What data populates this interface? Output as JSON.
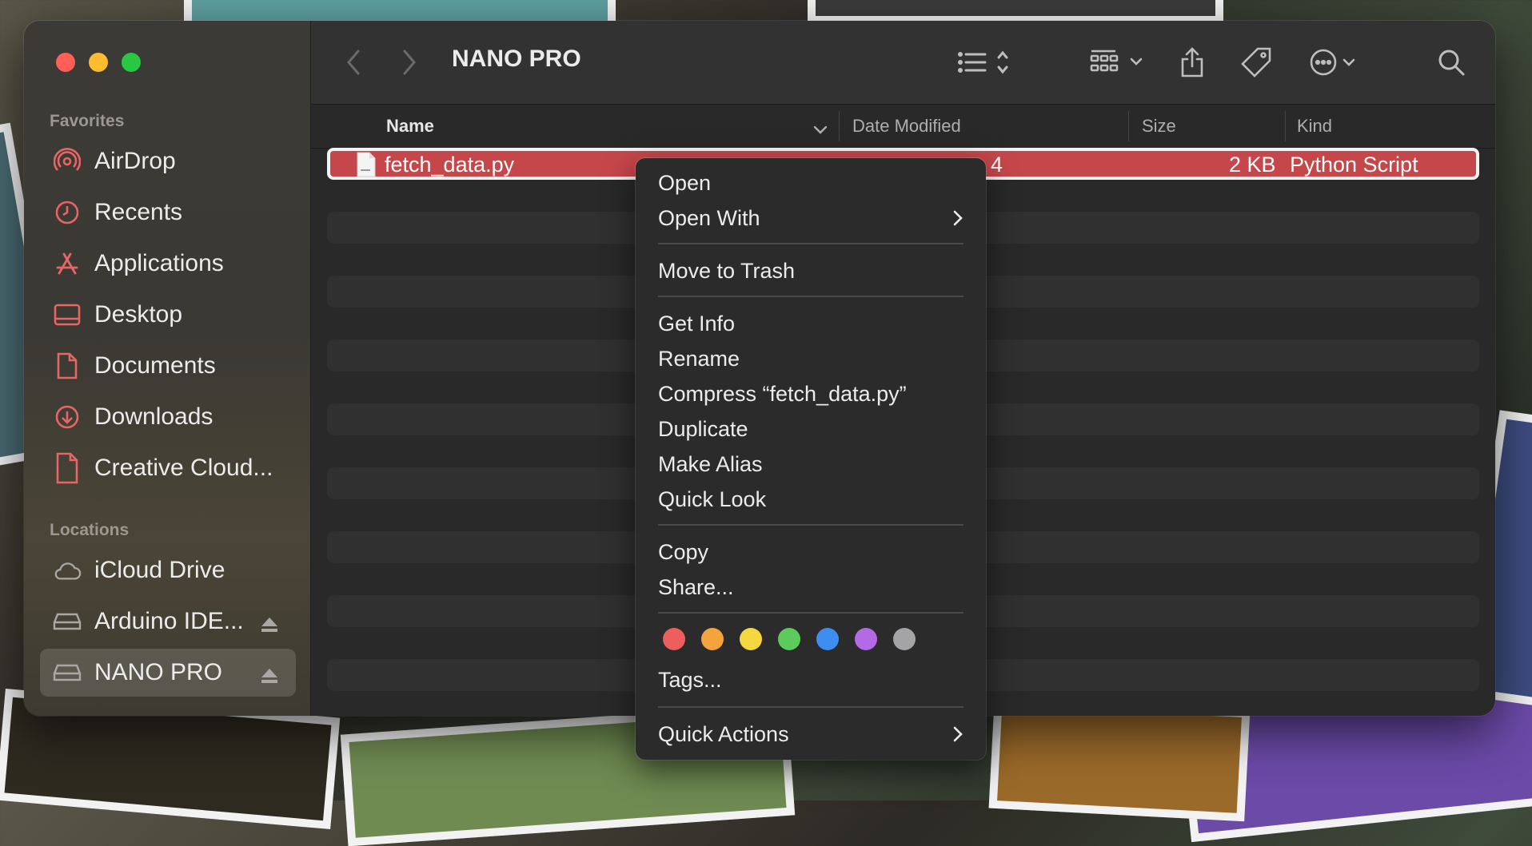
{
  "window": {
    "title": "NANO PRO"
  },
  "sidebar": {
    "favorites_heading": "Favorites",
    "favorites": [
      {
        "label": "AirDrop",
        "icon": "airdrop-icon"
      },
      {
        "label": "Recents",
        "icon": "clock-icon"
      },
      {
        "label": "Applications",
        "icon": "applications-icon"
      },
      {
        "label": "Desktop",
        "icon": "desktop-icon"
      },
      {
        "label": "Documents",
        "icon": "document-icon"
      },
      {
        "label": "Downloads",
        "icon": "download-icon"
      },
      {
        "label": "Creative Cloud...",
        "icon": "file-icon"
      }
    ],
    "locations_heading": "Locations",
    "locations": [
      {
        "label": "iCloud Drive",
        "icon": "cloud-icon"
      },
      {
        "label": "Arduino IDE...",
        "icon": "drive-icon",
        "ejectable": true
      },
      {
        "label": "NANO PRO",
        "icon": "drive-icon",
        "ejectable": true,
        "active": true
      }
    ]
  },
  "columns": {
    "name": "Name",
    "date": "Date Modified",
    "size": "Size",
    "kind": "Kind"
  },
  "files": [
    {
      "name": "fetch_data.py",
      "date_partial": "4",
      "size": "2 KB",
      "kind": "Python Script",
      "selected": true
    }
  ],
  "context_menu": {
    "open": "Open",
    "open_with": "Open With",
    "move_to_trash": "Move to Trash",
    "get_info": "Get Info",
    "rename": "Rename",
    "compress": "Compress “fetch_data.py”",
    "duplicate": "Duplicate",
    "make_alias": "Make Alias",
    "quick_look": "Quick Look",
    "copy": "Copy",
    "share": "Share...",
    "tags": "Tags...",
    "quick_actions": "Quick Actions",
    "tag_colors": [
      "#ec5f5d",
      "#f4a33d",
      "#f5d841",
      "#5dcb5b",
      "#3d8ef0",
      "#b46ae6",
      "#a4a4a6"
    ]
  },
  "colors": {
    "selection": "#c6474a",
    "accent_icon": "#e86565"
  }
}
